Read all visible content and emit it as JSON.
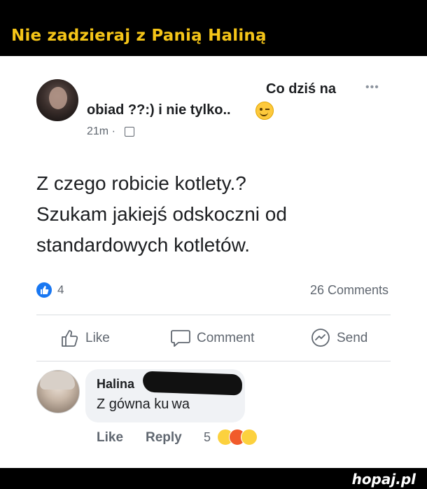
{
  "page": {
    "title": "Nie zadzieraj z Panią Haliną",
    "brand": "hopaj.pl"
  },
  "post": {
    "title_part1": "Co dziś na",
    "title_part2": "obiad ??:) i nie tylko..",
    "time": "21m ·",
    "text_line1": "Z czego robicie kotlety.?",
    "text_line2": "Szukam jakiejś odskoczni od",
    "text_line3": "standardowych kotletów.",
    "reactions_count": "4",
    "comments_count": "26 Comments"
  },
  "actions": {
    "like": "Like",
    "comment": "Comment",
    "send": "Send"
  },
  "comment": {
    "author": "Halina",
    "text": "Z gówna ku wa",
    "like": "Like",
    "reply": "Reply",
    "reactions_count": "5"
  },
  "icons": [
    "more-icon",
    "wink-emoji-icon",
    "friends-icon",
    "like-icon",
    "thumbs-up-icon",
    "comment-icon",
    "messenger-icon",
    "laugh-emoji-icon",
    "angry-emoji-icon",
    "wow-emoji-icon"
  ],
  "colors": {
    "header_text": "#f5c518",
    "like_blue": "#1877f2",
    "bubble": "#f0f2f5"
  }
}
